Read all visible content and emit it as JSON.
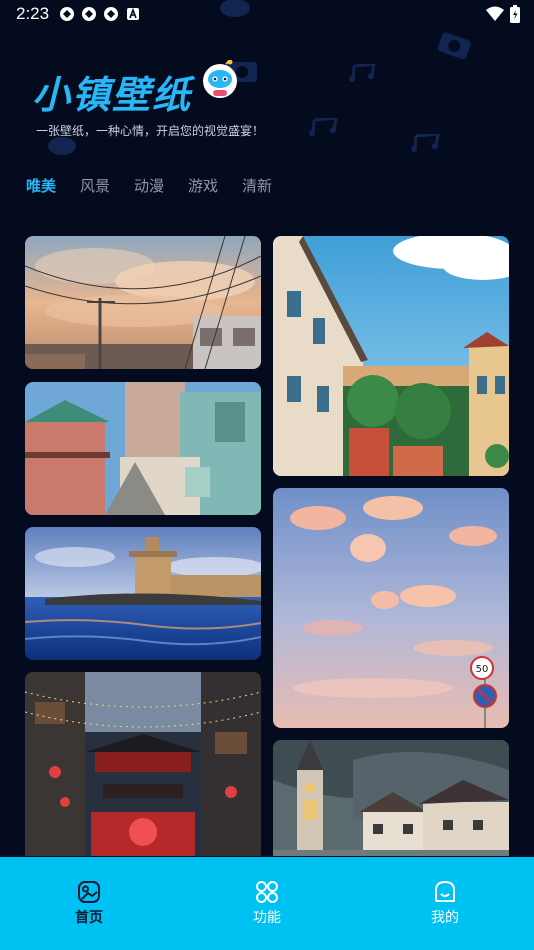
{
  "status": {
    "time": "2:23"
  },
  "app": {
    "title": "小镇壁纸",
    "slogan": "一张壁纸，一种心情，开启您的视觉盛宴！"
  },
  "tabs": [
    {
      "label": "唯美",
      "active": true
    },
    {
      "label": "风景",
      "active": false
    },
    {
      "label": "动漫",
      "active": false
    },
    {
      "label": "游戏",
      "active": false
    },
    {
      "label": "清新",
      "active": false
    }
  ],
  "wallpapers": {
    "left": [
      {
        "name": "anime-street-sky"
      },
      {
        "name": "anime-town-alley"
      },
      {
        "name": "sea-fort"
      },
      {
        "name": "night-old-street"
      }
    ],
    "right": [
      {
        "name": "european-street-houses"
      },
      {
        "name": "pink-cloud-sky"
      },
      {
        "name": "lakeside-village-church"
      }
    ]
  },
  "bottom_nav": [
    {
      "label": "首页",
      "icon": "gallery-icon",
      "active": true
    },
    {
      "label": "功能",
      "icon": "grid-icon",
      "active": false
    },
    {
      "label": "我的",
      "icon": "profile-icon",
      "active": false
    }
  ],
  "colors": {
    "accent": "#29b6f6",
    "background": "#040b1e",
    "nav": "#00c2f2"
  }
}
